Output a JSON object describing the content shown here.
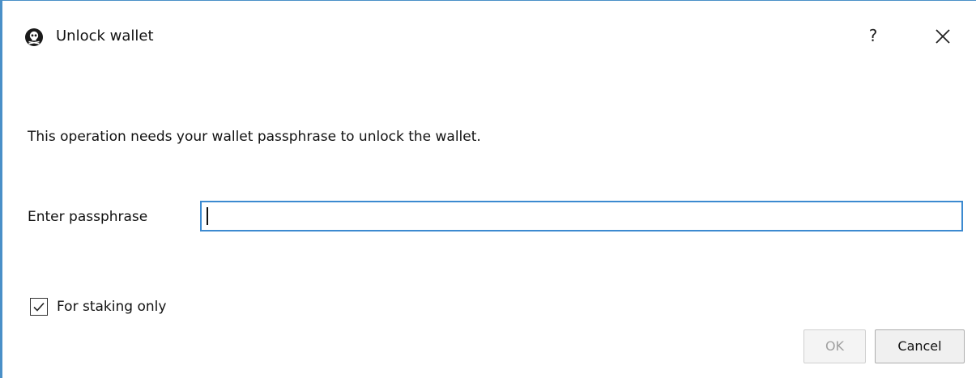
{
  "window": {
    "title": "Unlock wallet",
    "icon": "pirate-skull-icon",
    "help_label": "?",
    "close_icon": "close-icon"
  },
  "message": "This operation needs your wallet passphrase to unlock the wallet.",
  "passphrase": {
    "label": "Enter passphrase",
    "value": "",
    "placeholder": ""
  },
  "staking_checkbox": {
    "label": "For staking only",
    "checked": true
  },
  "buttons": {
    "ok_label": "OK",
    "ok_enabled": false,
    "cancel_label": "Cancel"
  },
  "colors": {
    "accent": "#3c8ad0",
    "window_border": "#4a90c8",
    "disabled_text": "#a0a0a0"
  }
}
